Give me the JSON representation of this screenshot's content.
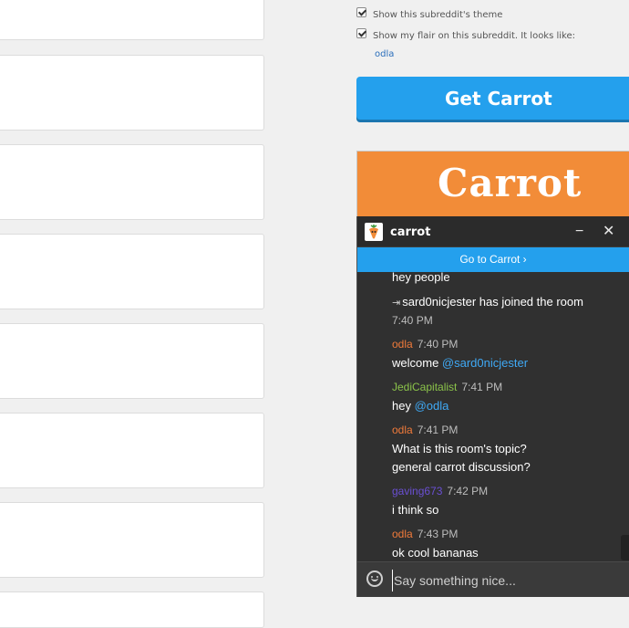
{
  "sidebar": {
    "options": [
      {
        "label": "Show this subreddit's theme",
        "checked": true
      },
      {
        "label": "Show my flair on this subreddit. It looks like:",
        "checked": true
      }
    ],
    "flair_value": "odla",
    "get_button_label": "Get Carrot",
    "banner_title": "Carrot"
  },
  "chat": {
    "title": "carrot",
    "minimize_glyph": "−",
    "close_glyph": "✕",
    "goto_label": "Go to Carrot ›",
    "messages": {
      "m0_text": "hey people",
      "join_text": "sard0nicjester has joined the room",
      "join_time": "7:40 PM",
      "m1_author": "odla",
      "m1_time": "7:40 PM",
      "m1_prefix": "welcome ",
      "m1_mention": "@sard0nicjester",
      "m2_author": "JediCapitalist",
      "m2_time": "7:41 PM",
      "m2_prefix": "hey ",
      "m2_mention": "@odla",
      "m3_author": "odla",
      "m3_time": "7:41 PM",
      "m3_line1": "What is this room's topic?",
      "m3_line2": "general carrot discussion?",
      "m4_author": "gaving673",
      "m4_time": "7:42 PM",
      "m4_text": "i think so",
      "m5_author": "odla",
      "m5_time": "7:43 PM",
      "m5_text": "ok cool bananas"
    },
    "input_placeholder": "Say something nice..."
  },
  "colors": {
    "accent_blue": "#24a0ed",
    "banner_orange": "#f28c38",
    "author_odla": "#f07a3a",
    "author_jedi": "#8bc34a",
    "author_gaving": "#6a4fd3",
    "mention": "#3fa9f5"
  },
  "icons": {
    "logo": "carrot-logo-icon",
    "emoji": "smiley-icon",
    "join": "join-arrow-icon"
  }
}
